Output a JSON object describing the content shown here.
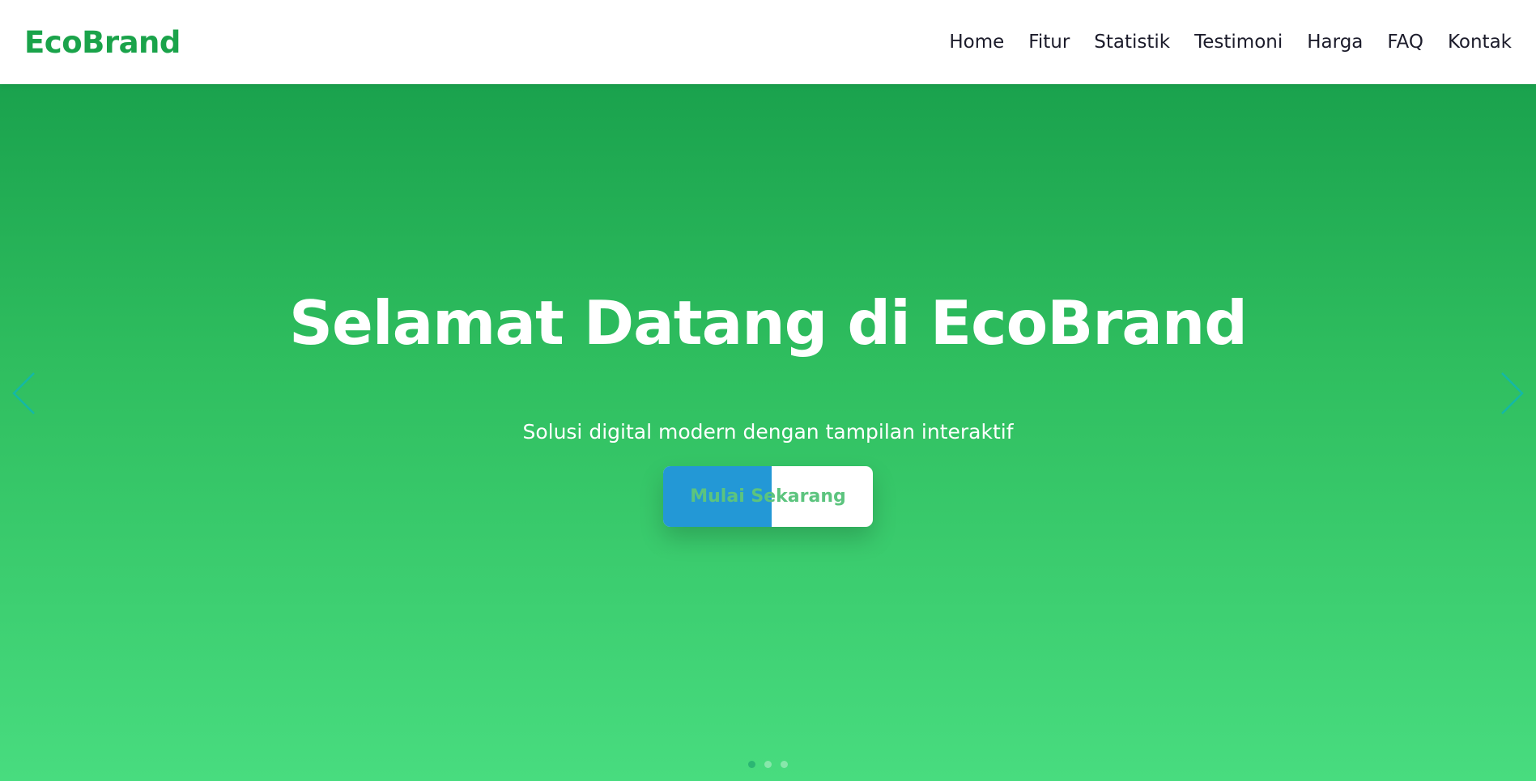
{
  "navbar": {
    "brand": "EcoBrand",
    "links": [
      "Home",
      "Fitur",
      "Statistik",
      "Testimoni",
      "Harga",
      "FAQ",
      "Kontak"
    ]
  },
  "hero": {
    "title": "Selamat Datang di EcoBrand",
    "subtitle": "Solusi digital modern dengan tampilan interaktif",
    "cta_label": "Mulai Sekarang",
    "slides": {
      "count": 3,
      "active_index": 0
    }
  },
  "icons": {
    "prev": "chevron-left-icon",
    "next": "chevron-right-icon"
  },
  "colors": {
    "brand": "#1aa34a",
    "hero_gradient_top": "#1aa24d",
    "hero_gradient_bottom": "#48dc7f",
    "cta_fill": "#2398d6",
    "cta_text": "#5cc47e",
    "arrow": "#14b8a6",
    "nav_text": "#1c1c2b"
  }
}
